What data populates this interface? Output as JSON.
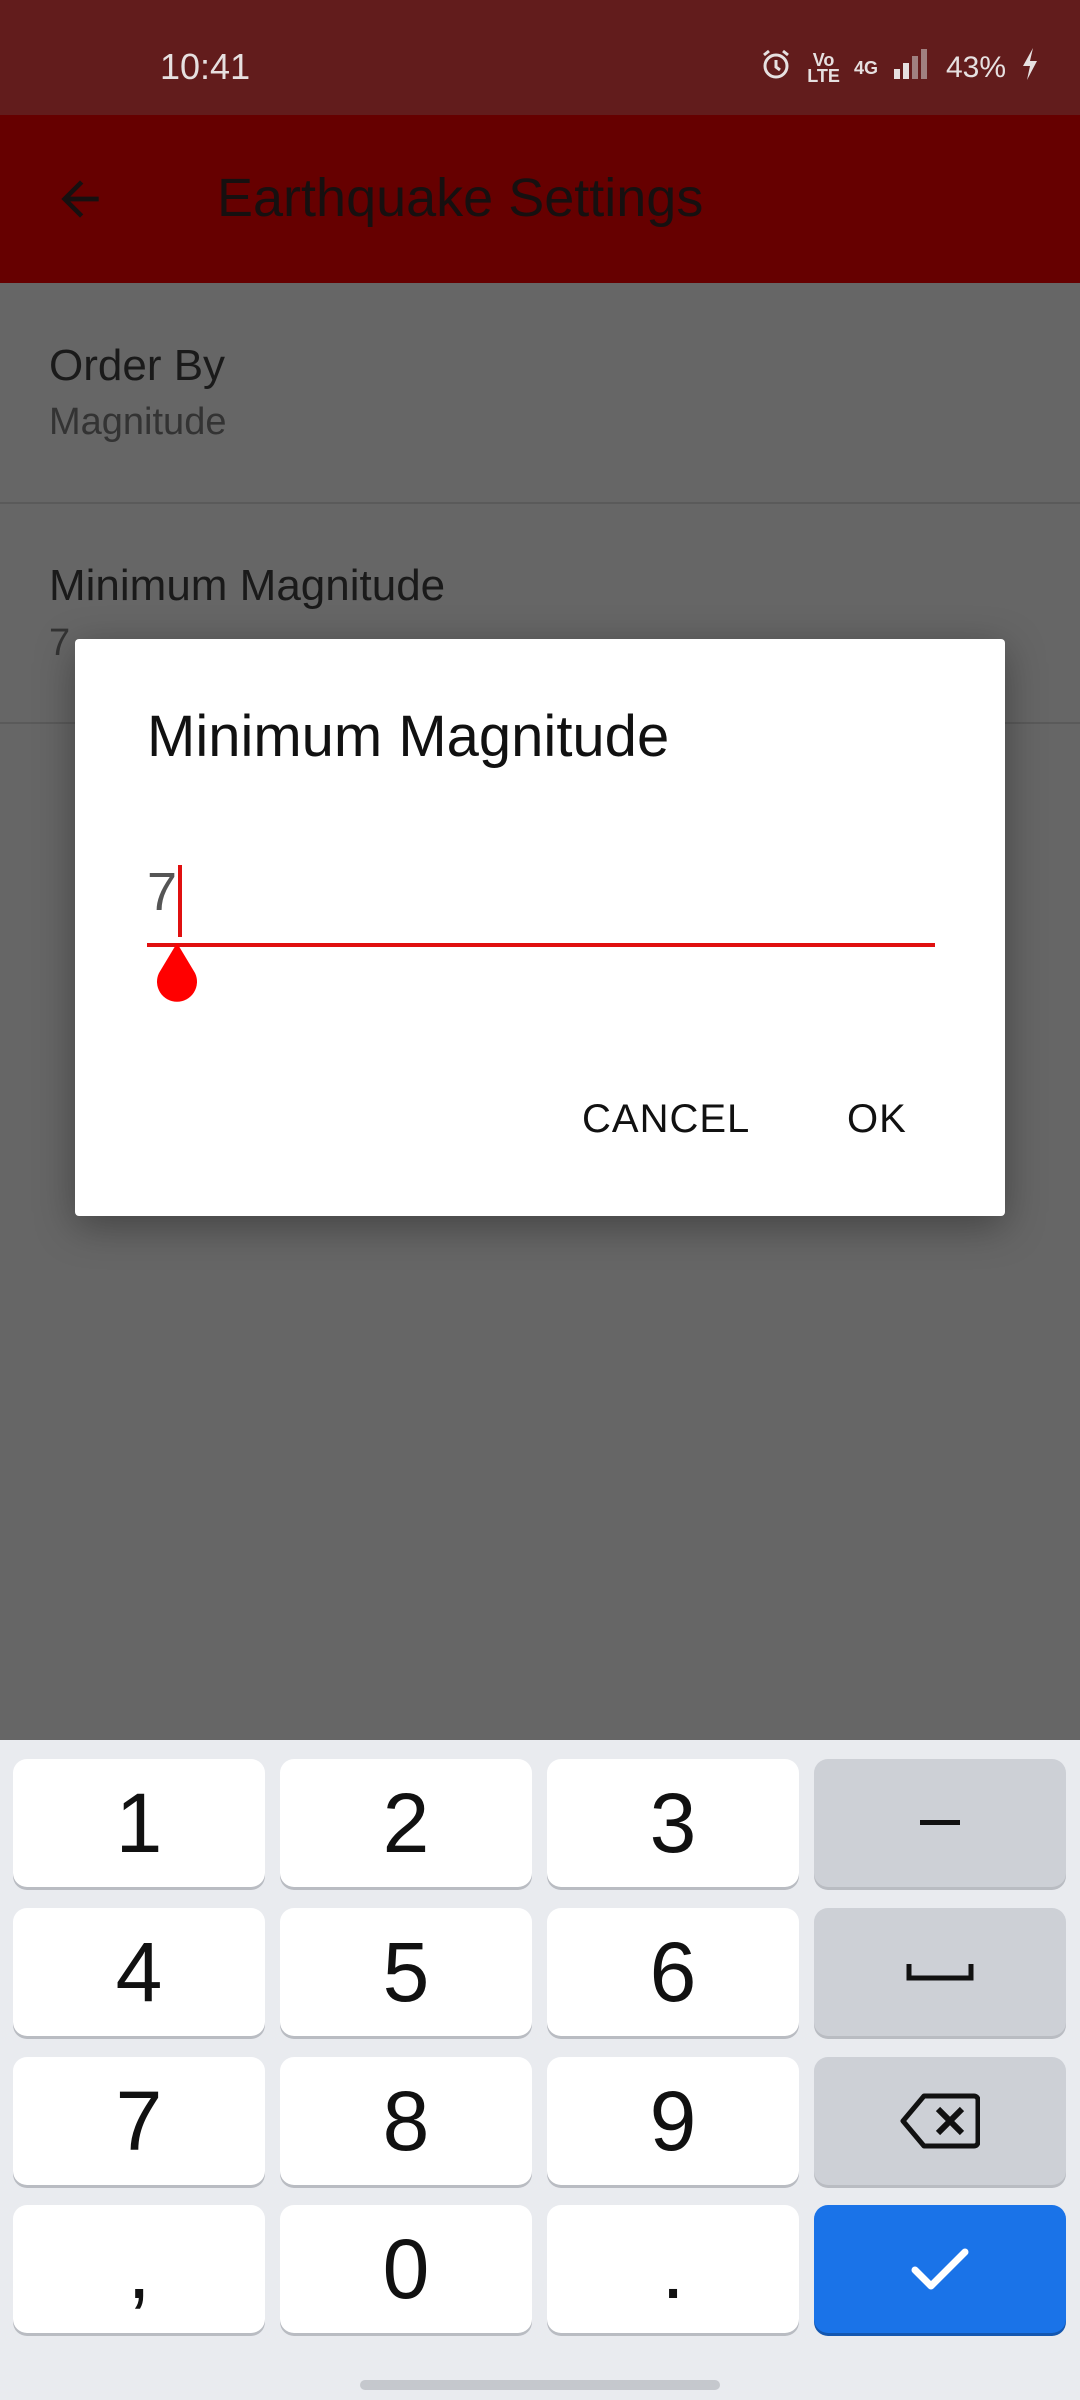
{
  "status_bar": {
    "time": "10:41",
    "volte_line1": "Vo",
    "volte_line2": "LTE",
    "network": "4G",
    "battery": "43%"
  },
  "app_bar": {
    "title": "Earthquake Settings",
    "back_icon": "arrow-back-icon"
  },
  "settings": {
    "order_by": {
      "title": "Order By",
      "summary": "Magnitude"
    },
    "min_magnitude": {
      "title": "Minimum Magnitude",
      "summary": "7"
    }
  },
  "dialog": {
    "title": "Minimum Magnitude",
    "input_value": "7",
    "cancel_label": "CANCEL",
    "ok_label": "OK"
  },
  "keyboard": {
    "rows": [
      [
        "1",
        "2",
        "3",
        "-"
      ],
      [
        "4",
        "5",
        "6",
        "␣"
      ],
      [
        "7",
        "8",
        "9",
        "⌫"
      ],
      [
        ",",
        "0",
        ".",
        "✓"
      ]
    ]
  },
  "colors": {
    "status_bar": "#621c1c",
    "app_bar": "#660000",
    "accent": "#e01010",
    "keyboard_action": "#1a73e8"
  }
}
